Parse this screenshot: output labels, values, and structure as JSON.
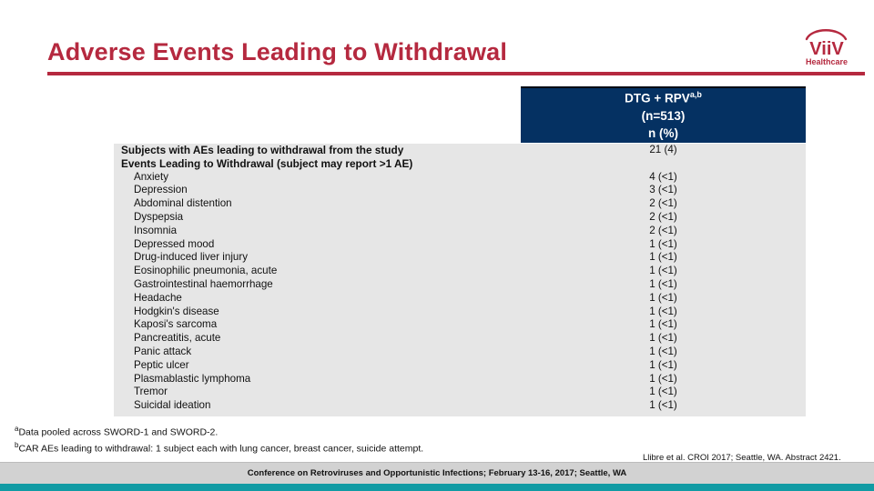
{
  "slide": {
    "title": "Adverse Events Leading to Withdrawal",
    "accent_color": "#b5293f",
    "header_bg_color": "#053162",
    "body_bg_color": "#e6e6e6",
    "banner_bg_color": "#d2d2d2",
    "teal_color": "#119ba4"
  },
  "logo": {
    "brand": "ViiV",
    "sub": "Healthcare"
  },
  "table": {
    "column_header": {
      "line1_main": "DTG + RPV",
      "line1_sup": "a,b",
      "line2": "(n=513)",
      "line3": "n (%)"
    },
    "rows": [
      {
        "label": "Subjects with AEs leading to withdrawal from the study",
        "value": "21 (4)",
        "kind": "head"
      },
      {
        "label": "Events Leading to Withdrawal (subject may report >1 AE)",
        "value": "",
        "kind": "head"
      },
      {
        "label": "Anxiety",
        "value": "4 (<1)",
        "kind": "item"
      },
      {
        "label": "Depression",
        "value": "3 (<1)",
        "kind": "item"
      },
      {
        "label": "Abdominal distention",
        "value": "2 (<1)",
        "kind": "item"
      },
      {
        "label": "Dyspepsia",
        "value": "2 (<1)",
        "kind": "item"
      },
      {
        "label": "Insomnia",
        "value": "2 (<1)",
        "kind": "item"
      },
      {
        "label": "Depressed mood",
        "value": "1 (<1)",
        "kind": "item"
      },
      {
        "label": "Drug-induced liver injury",
        "value": "1 (<1)",
        "kind": "item"
      },
      {
        "label": "Eosinophilic pneumonia, acute",
        "value": "1 (<1)",
        "kind": "item"
      },
      {
        "label": "Gastrointestinal haemorrhage",
        "value": "1 (<1)",
        "kind": "item"
      },
      {
        "label": "Headache",
        "value": "1 (<1)",
        "kind": "item"
      },
      {
        "label": "Hodgkin's disease",
        "value": "1 (<1)",
        "kind": "item"
      },
      {
        "label": "Kaposi's sarcoma",
        "value": "1 (<1)",
        "kind": "item"
      },
      {
        "label": "Pancreatitis, acute",
        "value": "1 (<1)",
        "kind": "item"
      },
      {
        "label": "Panic attack",
        "value": "1 (<1)",
        "kind": "item"
      },
      {
        "label": "Peptic ulcer",
        "value": "1 (<1)",
        "kind": "item"
      },
      {
        "label": "Plasmablastic lymphoma",
        "value": "1 (<1)",
        "kind": "item"
      },
      {
        "label": "Tremor",
        "value": "1 (<1)",
        "kind": "item"
      },
      {
        "label": "Suicidal ideation",
        "value": "1 (<1)",
        "kind": "item"
      }
    ]
  },
  "footnotes": {
    "a_mark": "a",
    "a_text": "Data pooled across SWORD-1 and SWORD-2.",
    "b_mark": "b",
    "b_text": "CAR AEs leading to withdrawal: 1 subject each with lung cancer, breast cancer, suicide attempt."
  },
  "citation": "Llibre et al. CROI 2017; Seattle, WA. Abstract 2421.",
  "banner": {
    "text": "Conference on Retroviruses and Opportunistic Infections; February 13-16, 2017; Seattle, WA"
  }
}
